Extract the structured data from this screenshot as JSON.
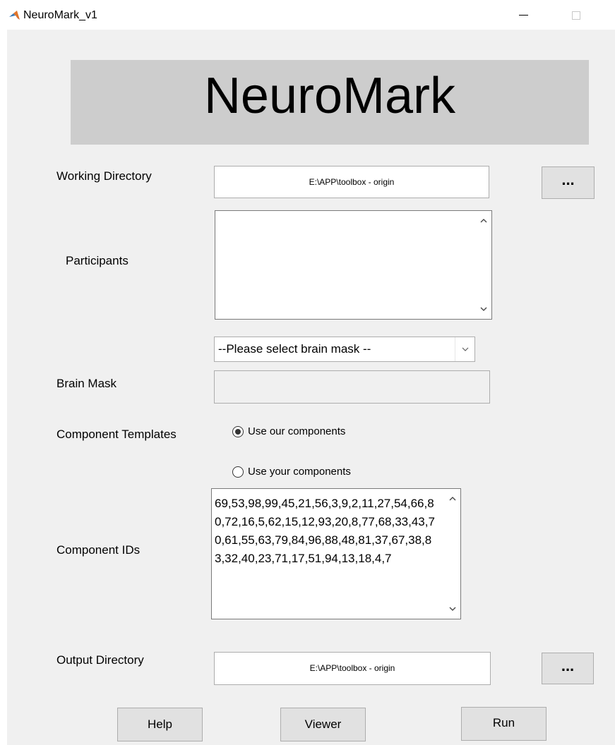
{
  "window": {
    "title": "NeuroMark_v1"
  },
  "banner": {
    "title": "NeuroMark"
  },
  "working_directory": {
    "label": "Working Directory",
    "value": "E:\\APP\\toolbox - origin",
    "browse_label": "..."
  },
  "participants": {
    "label": "Participants"
  },
  "brain_mask": {
    "select_value": "--Please select brain mask --",
    "label": "Brain Mask",
    "value": ""
  },
  "component_templates": {
    "label": "Component Templates",
    "options": [
      {
        "label": "Use our components",
        "selected": true
      },
      {
        "label": "Use your components",
        "selected": false
      }
    ]
  },
  "component_ids": {
    "label": "Component IDs",
    "value": "69,53,98,99,45,21,56,3,9,2,11,27,54,66,80,72,16,5,62,15,12,93,20,8,77,68,33,43,70,61,55,63,79,84,96,88,48,81,37,67,38,83,32,40,23,71,17,51,94,13,18,4,7"
  },
  "output_directory": {
    "label": "Output Directory",
    "value": "E:\\APP\\toolbox - origin",
    "browse_label": "..."
  },
  "buttons": {
    "help": "Help",
    "viewer": "Viewer",
    "run": "Run"
  }
}
